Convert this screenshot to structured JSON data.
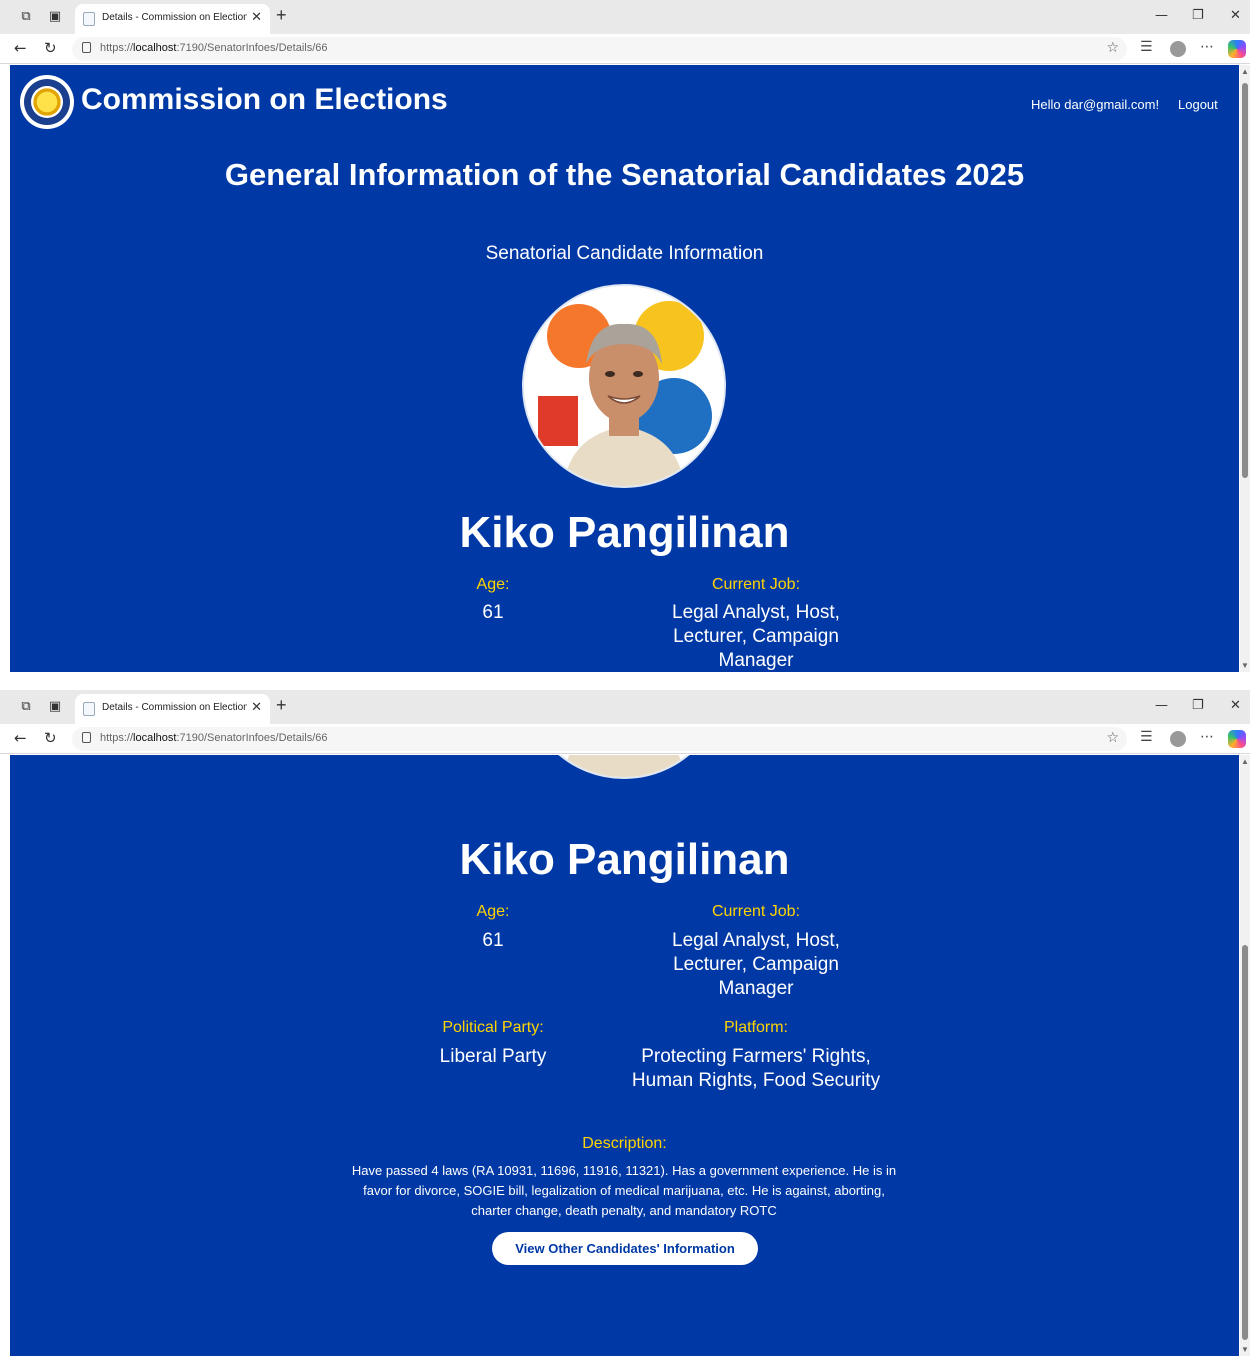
{
  "browser": {
    "tab_title": "Details - Commission on Election",
    "url_prefix": "https://",
    "url_host": "localhost",
    "url_path": ":7190/SenatorInfoes/Details/66"
  },
  "site": {
    "brand": "Commission on Elections",
    "greeting": "Hello dar@gmail.com!",
    "logout": "Logout"
  },
  "page": {
    "title": "General Information of the Senatorial Candidates 2025",
    "section_title": "Senatorial Candidate Information"
  },
  "candidate": {
    "name": "Kiko Pangilinan",
    "age_label": "Age:",
    "age": "61",
    "job_label": "Current Job:",
    "job": "Legal Analyst, Host, Lecturer, Campaign Manager",
    "party_label": "Political Party:",
    "party": "Liberal Party",
    "platform_label": "Platform:",
    "platform": "Protecting Farmers' Rights, Human Rights, Food Security",
    "description_label": "Description:",
    "description": "Have passed 4 laws (RA 10931, 11696, 11916, 11321). Has a government experience. He is in favor for divorce, SOGIE bill, legalization of medical marijuana, etc. He is against, aborting, charter change, death penalty, and mandatory ROTC"
  },
  "actions": {
    "view_others": "View Other Candidates' Information"
  },
  "colors": {
    "page_background": "#0039a6",
    "label_accent": "#ffd400",
    "text": "#ffffff"
  },
  "icons": [
    "workspaces-icon",
    "tab-actions-icon",
    "page-favicon",
    "close-icon",
    "new-tab-icon",
    "minimize-icon",
    "restore-icon",
    "window-close-icon",
    "back-icon",
    "refresh-icon",
    "lock-icon",
    "star-icon",
    "favorites-icon",
    "profile-icon",
    "more-icon",
    "copilot-icon",
    "comelec-seal-icon"
  ]
}
